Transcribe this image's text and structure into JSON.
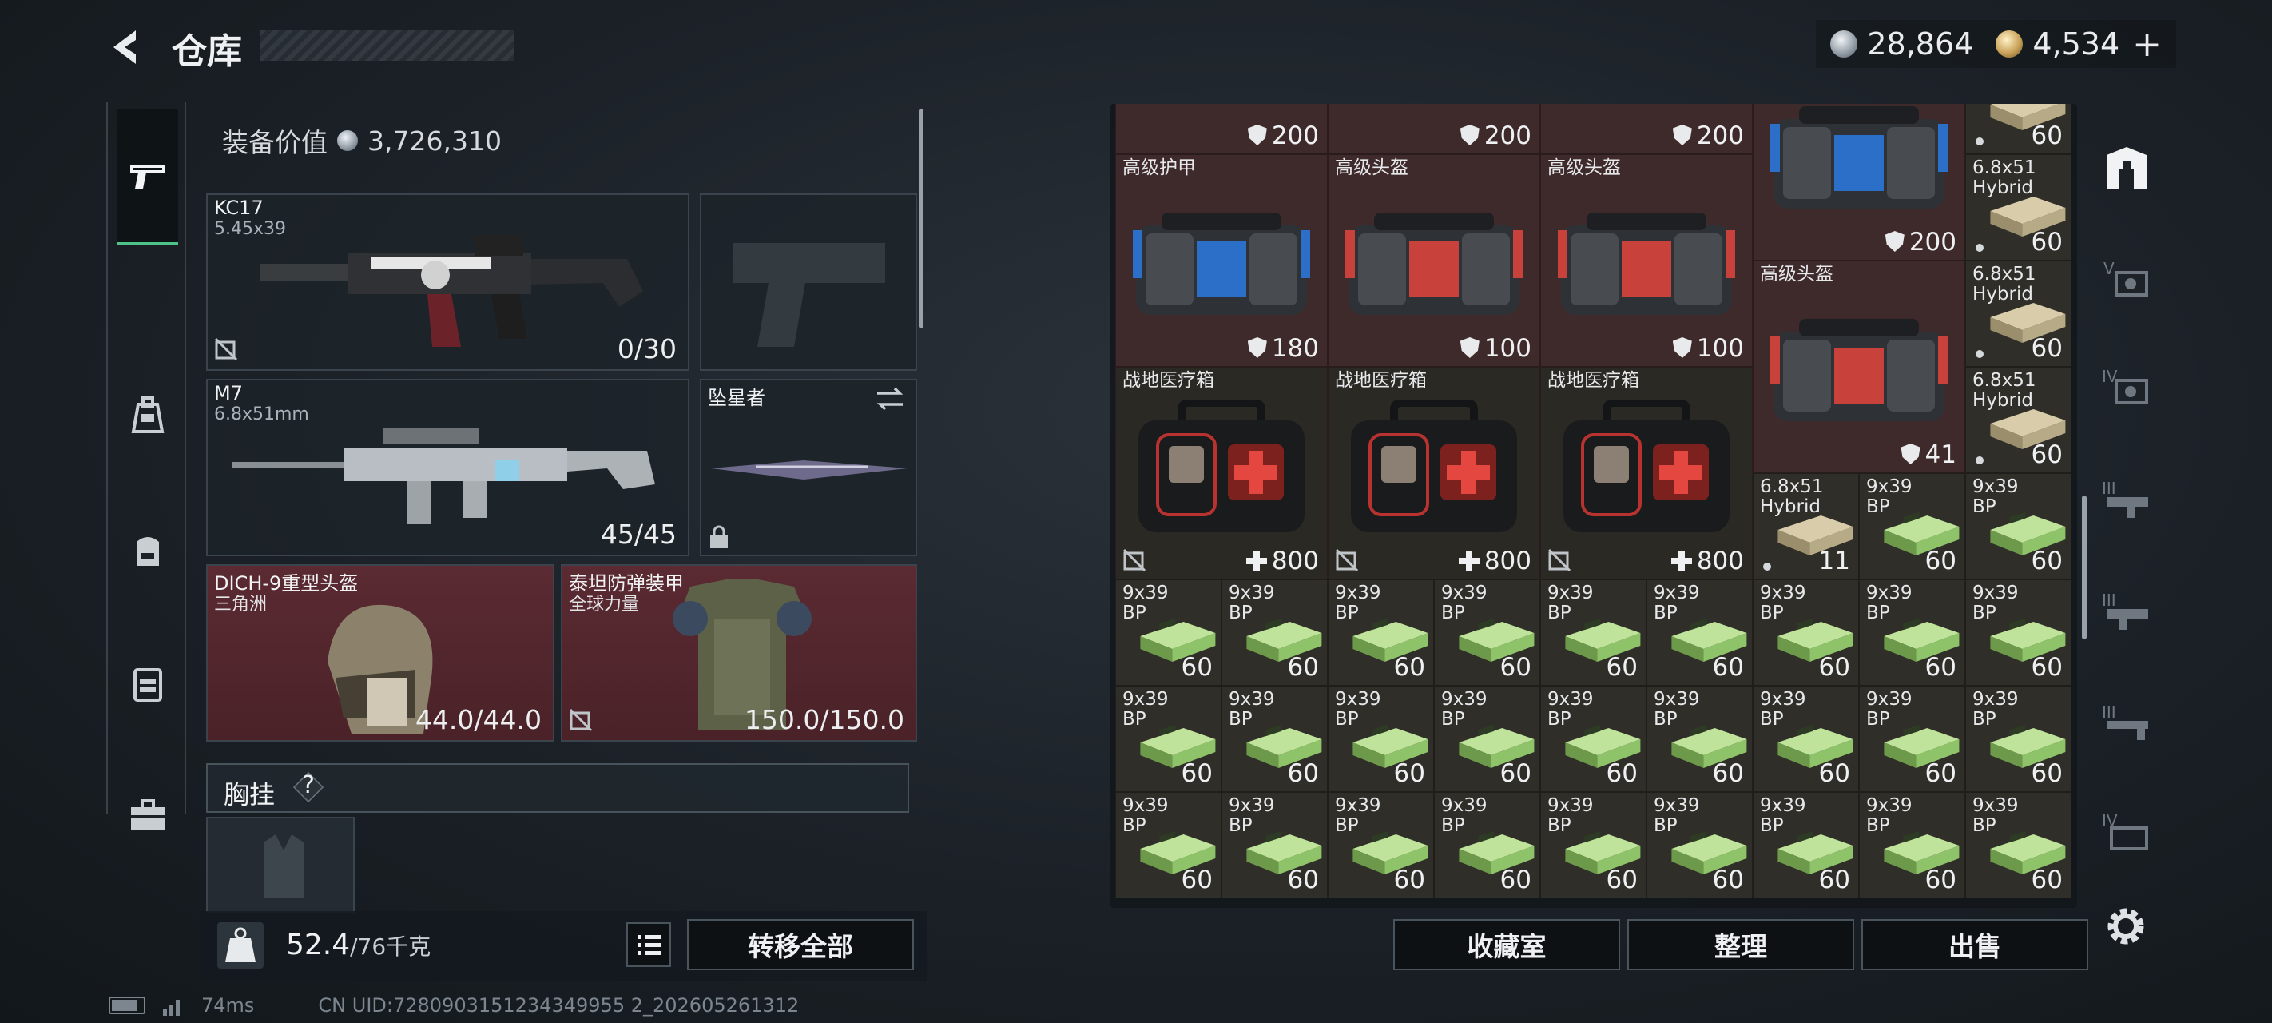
{
  "header": {
    "title": "仓库",
    "silver": "28,864",
    "gold": "4,534",
    "gold_plus": "+"
  },
  "colors": {
    "accent": "#4fc28a",
    "red_slot": "#5b2a32",
    "green_ammo": "#8fc36a"
  },
  "equip": {
    "value_label": "装备价值",
    "value": "3,726,310",
    "primary": {
      "name": "KC17",
      "sub": "5.45x39",
      "count": "0/30"
    },
    "secondary": {
      "name": "M7",
      "sub": "6.8x51mm",
      "count": "45/45"
    },
    "melee": {
      "name": "坠星者"
    },
    "helmet": {
      "name": "DICH-9重型头盔",
      "sub": "三角洲",
      "count": "44.0/44.0"
    },
    "armor": {
      "name": "泰坦防弹装甲",
      "sub": "全球力量",
      "count": "150.0/150.0"
    },
    "chest_label": "胸挂",
    "chest_q": "?"
  },
  "weight": {
    "current": "52.4",
    "max": "/76千克",
    "transfer": "转移全部"
  },
  "footer": {
    "ping": "74ms",
    "uid": "CN UID:7280903151234349955 2_202605261312"
  },
  "bottom_buttons": {
    "collection": "收藏室",
    "sort": "整理",
    "sell": "出售"
  },
  "grid": {
    "top_vals": [
      "200",
      "200",
      "200"
    ],
    "bags": [
      {
        "name": "高级护甲",
        "value": "180",
        "accent": "blue"
      },
      {
        "name": "高级头盔",
        "value": "100",
        "accent": "red"
      },
      {
        "name": "高级头盔",
        "value": "100",
        "accent": "red"
      }
    ],
    "col4_top": {
      "value": "200"
    },
    "col4_second": {
      "name": "高级头盔",
      "value": "41"
    },
    "medkits": [
      {
        "name": "战地医疗箱",
        "value": "800"
      },
      {
        "name": "战地医疗箱",
        "value": "800"
      },
      {
        "name": "战地医疗箱",
        "value": "800"
      }
    ],
    "col5": [
      {
        "name": "",
        "sub": "",
        "count": "60"
      },
      {
        "name": "6.8x51",
        "sub": "Hybrid",
        "count": "60"
      },
      {
        "name": "6.8x51",
        "sub": "Hybrid",
        "count": "60"
      },
      {
        "name": "6.8x51",
        "sub": "Hybrid",
        "count": "60"
      }
    ],
    "row4": [
      {
        "name": "6.8x51",
        "sub": "Hybrid",
        "count": "11"
      },
      {
        "name": "9x39",
        "sub": "BP",
        "count": "60"
      },
      {
        "name": "9x39",
        "sub": "BP",
        "count": "60"
      }
    ],
    "ammo_label": "9x39",
    "ammo_sub": "BP",
    "ammo_count": "60"
  },
  "icons": {
    "back": "back-arrow-icon",
    "sidebar": [
      "pistol-icon",
      "backpack-rig-icon",
      "backpack-icon",
      "armor-vest-icon",
      "toolbox-icon"
    ],
    "filters": [
      "grid-home-icon",
      "level-v-armor-icon",
      "level-iv-armor-icon",
      "level-iii-rifle-icon",
      "level-iii-smg-icon",
      "level-iii-pistol-icon",
      "level-iv-ammo-icon"
    ]
  }
}
